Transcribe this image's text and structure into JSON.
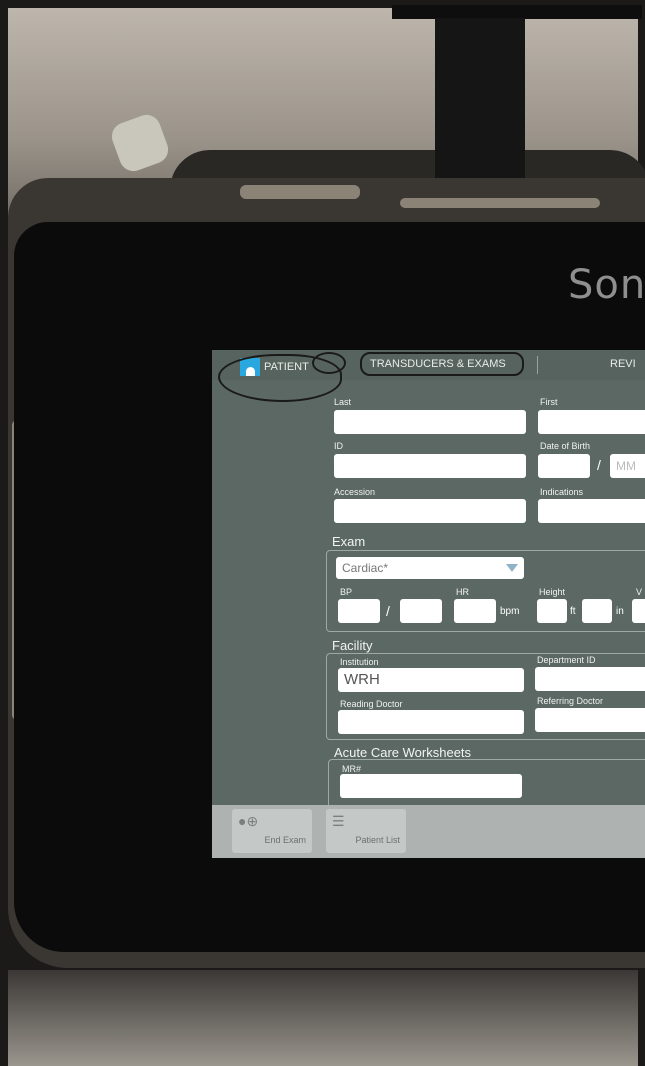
{
  "brand": "Sono",
  "tabs": {
    "patient": "PATIENT",
    "transducers": "TRANSDUCERS & EXAMS",
    "review": "REVI"
  },
  "patient": {
    "last_label": "Last",
    "first_label": "First",
    "id_label": "ID",
    "dob_label": "Date of Birth",
    "dob_sep": "/",
    "dob_placeholder": "MM",
    "accession_label": "Accession",
    "indications_label": "Indications"
  },
  "exam": {
    "title": "Exam",
    "type_value": "Cardiac*",
    "bp_label": "BP",
    "bp_sep": "/",
    "hr_label": "HR",
    "hr_unit": "bpm",
    "height_label": "Height",
    "ft_unit": "ft",
    "in_unit": "in",
    "weight_label_partial": "V"
  },
  "facility": {
    "title": "Facility",
    "institution_label": "Institution",
    "institution_value": "WRH",
    "department_label": "Department ID",
    "reading_doctor_label": "Reading Doctor",
    "referring_doctor_label": "Referring Doctor"
  },
  "worksheets": {
    "title": "Acute Care Worksheets",
    "mr_label": "MR#"
  },
  "bottom": {
    "end_exam": "End Exam",
    "patient_list": "Patient List"
  },
  "colors": {
    "screen_bg": "#5c6863",
    "accent": "#29a8e0"
  }
}
